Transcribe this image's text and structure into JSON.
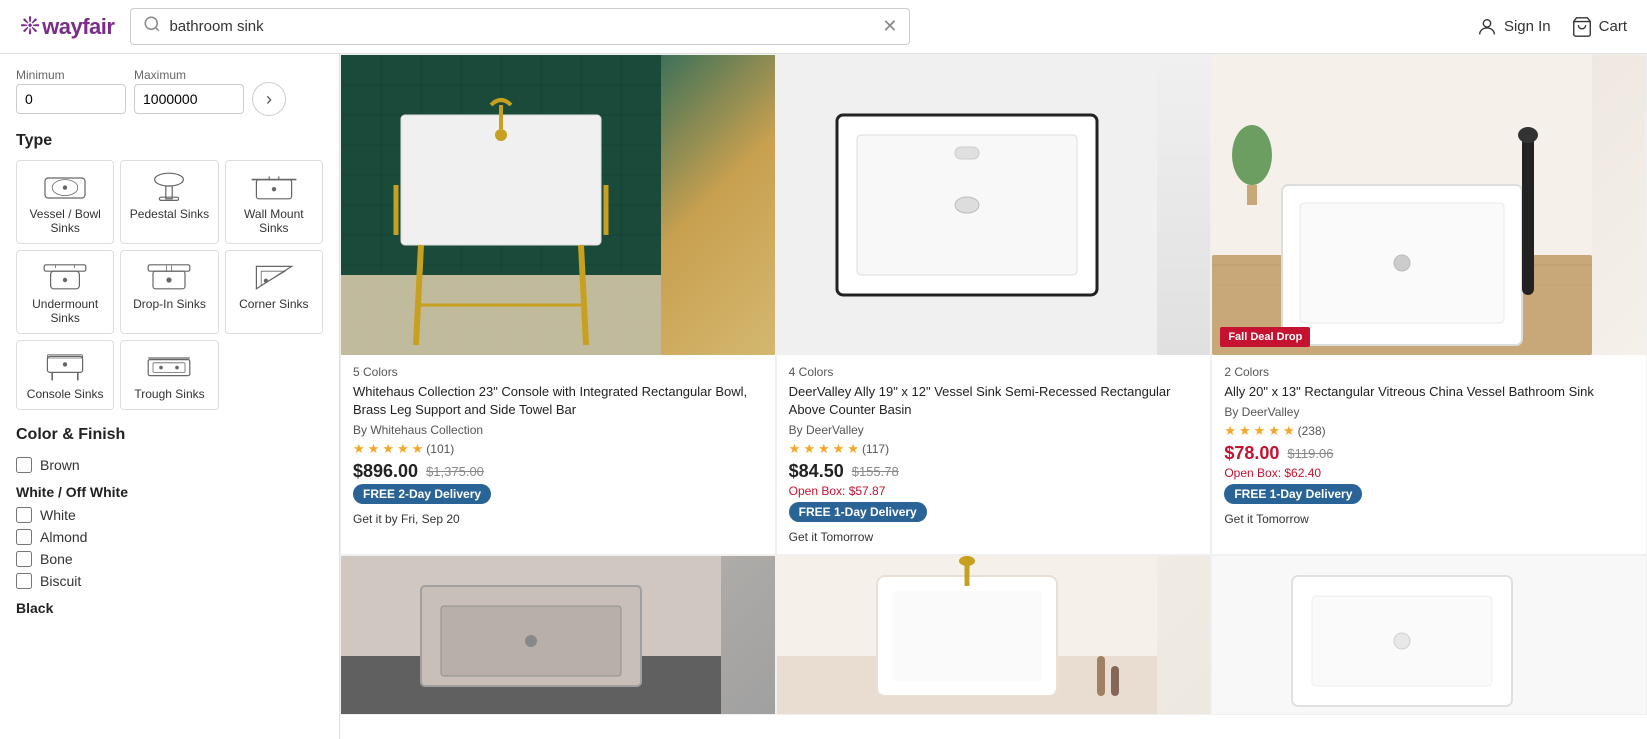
{
  "header": {
    "logo_text": "wayfair",
    "search_placeholder": "bathroom sink",
    "search_value": "bathroom sink",
    "sign_in_label": "Sign In",
    "cart_label": "Cart"
  },
  "sidebar": {
    "price": {
      "min_label": "Minimum",
      "max_label": "Maximum",
      "min_value": "0",
      "max_value": "1000000"
    },
    "type_section_title": "Type",
    "types": [
      {
        "id": "vessel-bowl",
        "label": "Vessel / Bowl Sinks"
      },
      {
        "id": "pedestal",
        "label": "Pedestal Sinks"
      },
      {
        "id": "wall-mount",
        "label": "Wall Mount Sinks"
      },
      {
        "id": "undermount",
        "label": "Undermount Sinks"
      },
      {
        "id": "drop-in",
        "label": "Drop-In Sinks"
      },
      {
        "id": "corner",
        "label": "Corner Sinks"
      },
      {
        "id": "console",
        "label": "Console Sinks"
      },
      {
        "id": "trough",
        "label": "Trough Sinks"
      }
    ],
    "color_section_title": "Color & Finish",
    "color_groups": [
      {
        "group": "Brown",
        "items": [
          "Brown"
        ]
      },
      {
        "group": "White / Off White",
        "items": [
          "White",
          "Almond",
          "Bone",
          "Biscuit"
        ]
      },
      {
        "group": "Black",
        "items": []
      }
    ]
  },
  "products": [
    {
      "id": "prod1",
      "colors_count": "5 Colors",
      "name": "Whitehaus Collection 23\" Console with Integrated Rectangular Bowl, Brass Leg Support and Side Towel Bar",
      "brand": "By Whitehaus Collection",
      "rating": 4.5,
      "reviews": 101,
      "price": "$896.00",
      "original_price": "$1,375.00",
      "sale": false,
      "open_box": null,
      "delivery_type": "FREE 2-Day Delivery",
      "delivery_speed": "two-day",
      "delivery_date": "Get it by Fri, Sep 20",
      "image_class": "sink1",
      "deal_badge": null
    },
    {
      "id": "prod2",
      "colors_count": "4 Colors",
      "name": "DeerValley Ally 19\" x 12\" Vessel Sink Semi-Recessed Rectangular Above Counter Basin",
      "brand": "By DeerValley",
      "rating": 4.5,
      "reviews": 117,
      "price": "$84.50",
      "original_price": "$155.78",
      "sale": false,
      "open_box": "Open Box: $57.87",
      "delivery_type": "FREE 1-Day Delivery",
      "delivery_speed": "one-day",
      "delivery_date": "Get it Tomorrow",
      "image_class": "sink2",
      "deal_badge": null
    },
    {
      "id": "prod3",
      "colors_count": "2 Colors",
      "name": "Ally 20\" x 13\" Rectangular Vitreous China Vessel Bathroom Sink",
      "brand": "By DeerValley",
      "rating": 4.5,
      "reviews": 238,
      "price": "$78.00",
      "original_price": "$119.06",
      "sale": true,
      "open_box": "Open Box: $62.40",
      "delivery_type": "FREE 1-Day Delivery",
      "delivery_speed": "one-day",
      "delivery_date": "Get it Tomorrow",
      "image_class": "sink3",
      "deal_badge": "Fall Deal Drop"
    },
    {
      "id": "prod4",
      "colors_count": "",
      "name": "",
      "brand": "",
      "rating": 0,
      "reviews": 0,
      "price": "",
      "original_price": "",
      "sale": false,
      "open_box": null,
      "delivery_type": "",
      "delivery_speed": "one-day",
      "delivery_date": "",
      "image_class": "sink4",
      "deal_badge": null
    },
    {
      "id": "prod5",
      "colors_count": "",
      "name": "",
      "brand": "",
      "rating": 0,
      "reviews": 0,
      "price": "",
      "original_price": "",
      "sale": false,
      "open_box": null,
      "delivery_type": "",
      "delivery_speed": "one-day",
      "delivery_date": "",
      "image_class": "sink5",
      "deal_badge": null
    },
    {
      "id": "prod6",
      "colors_count": "",
      "name": "",
      "brand": "",
      "rating": 0,
      "reviews": 0,
      "price": "",
      "original_price": "",
      "sale": false,
      "open_box": null,
      "delivery_type": "",
      "delivery_speed": "one-day",
      "delivery_date": "",
      "image_class": "sink6",
      "deal_badge": null
    }
  ]
}
